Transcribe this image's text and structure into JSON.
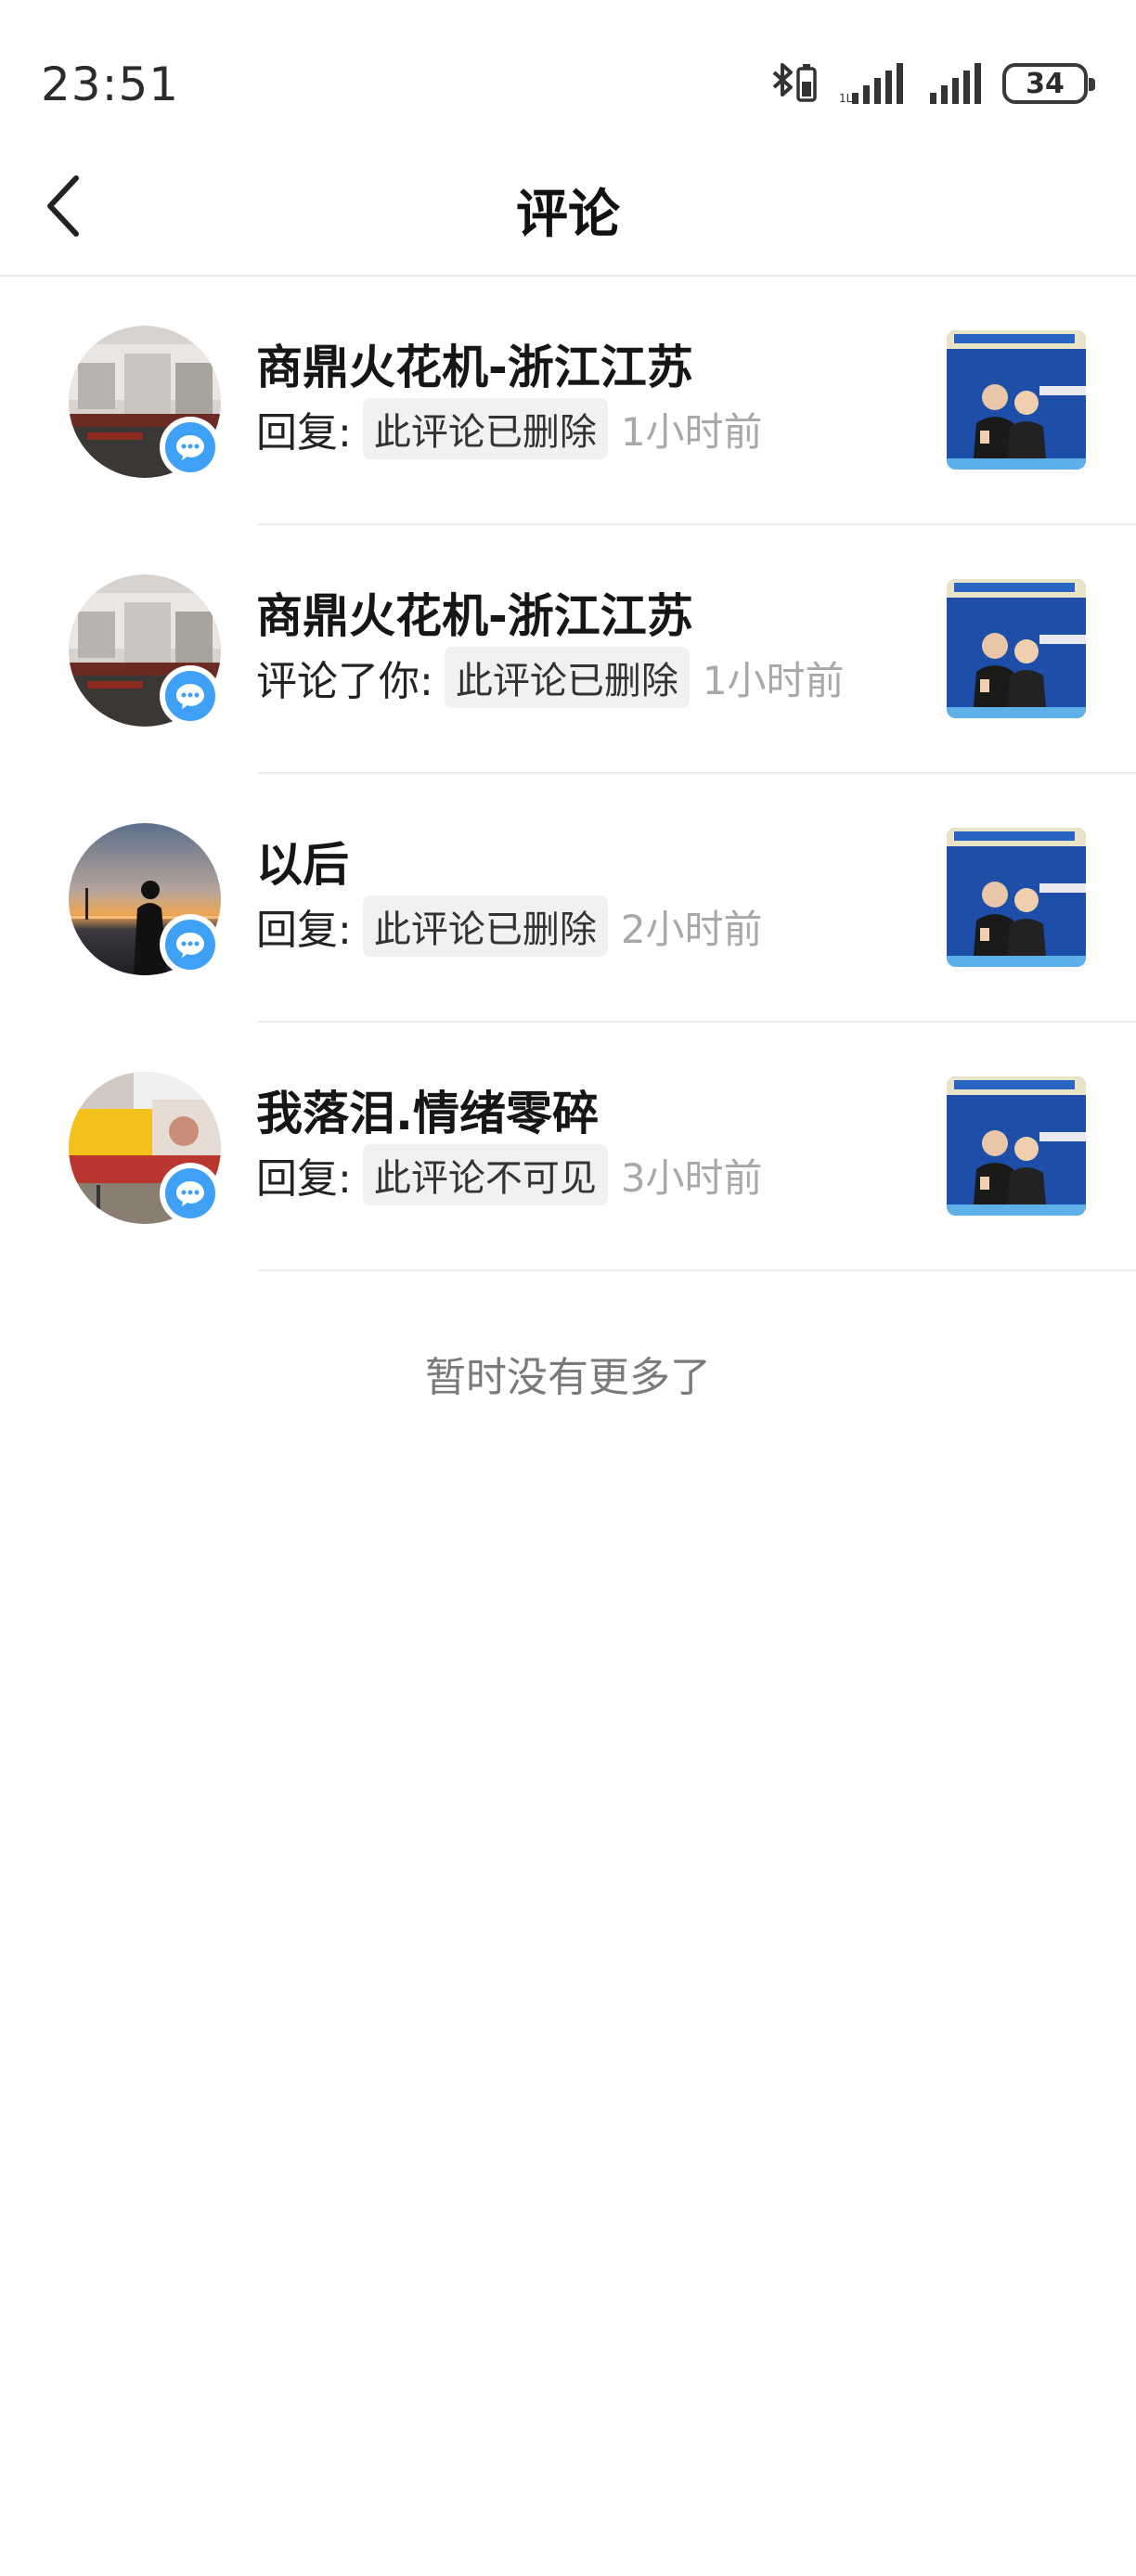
{
  "status_bar": {
    "time": "23:51",
    "battery": "34"
  },
  "nav": {
    "title": "评论"
  },
  "comments": [
    {
      "username": "商鼎火花机-浙江江苏",
      "action": "回复:",
      "comment": "此评论已删除",
      "time": "1小时前"
    },
    {
      "username": "商鼎火花机-浙江江苏",
      "action": "评论了你:",
      "comment": "此评论已删除",
      "time": "1小时前"
    },
    {
      "username": "以后",
      "action": "回复:",
      "comment": "此评论已删除",
      "time": "2小时前"
    },
    {
      "username": "我落泪.情绪零碎",
      "action": "回复:",
      "comment": "此评论不可见",
      "time": "3小时前"
    }
  ],
  "footer": {
    "end_text": "暂时没有更多了"
  },
  "icons": {
    "back": "back-arrow-icon",
    "badge": "comment-bubble-icon",
    "bluetooth": "bluetooth-icon",
    "signal": "signal-icon",
    "battery": "battery-icon"
  },
  "colors": {
    "badge_blue": "#3fa1f5",
    "time_gray": "#a8a8a8",
    "divider": "#ececec"
  }
}
